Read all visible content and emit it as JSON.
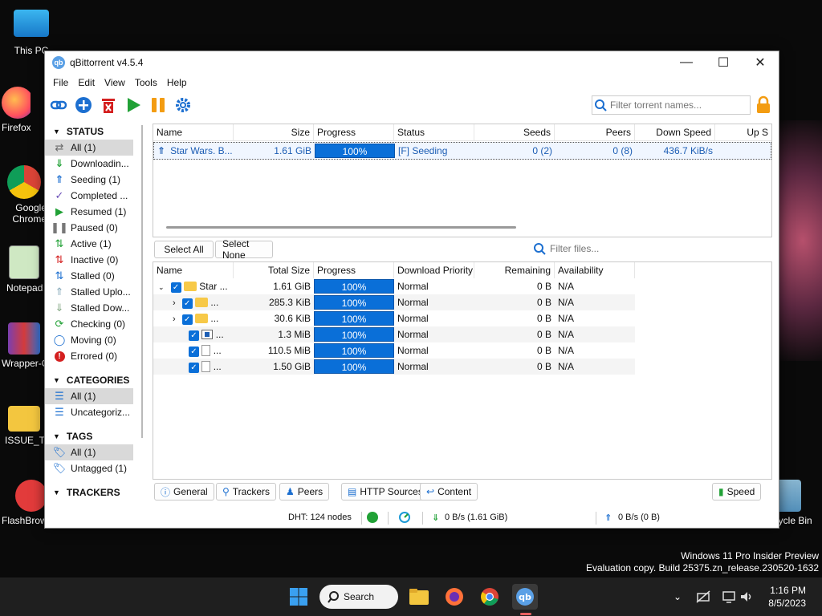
{
  "desktop": {
    "icons": [
      {
        "label": "This PC"
      },
      {
        "label": "Firefox"
      },
      {
        "label": "Google Chrome"
      },
      {
        "label": "Notepad"
      },
      {
        "label": "Wrapper-C"
      },
      {
        "label": "ISSUE_TE"
      },
      {
        "label": "FlashBrowser"
      },
      {
        "label": "Recycle Bin"
      }
    ],
    "watermark_line1": "Windows 11 Pro Insider Preview",
    "watermark_line2": "Evaluation copy. Build 25375.zn_release.230520-1632"
  },
  "window": {
    "title": "qBittorrent v4.5.4",
    "menu": [
      "File",
      "Edit",
      "View",
      "Tools",
      "Help"
    ],
    "search_placeholder": "Filter torrent names..."
  },
  "sidebar": {
    "status_header": "STATUS",
    "status_items": [
      {
        "label": "All (1)",
        "icon": "all-icon"
      },
      {
        "label": "Downloadin...",
        "icon": "downloading-icon"
      },
      {
        "label": "Seeding (1)",
        "icon": "seeding-icon"
      },
      {
        "label": "Completed ...",
        "icon": "check-icon"
      },
      {
        "label": "Resumed (1)",
        "icon": "play-icon"
      },
      {
        "label": "Paused (0)",
        "icon": "pause-icon"
      },
      {
        "label": "Active (1)",
        "icon": "active-icon"
      },
      {
        "label": "Inactive (0)",
        "icon": "inactive-icon"
      },
      {
        "label": "Stalled (0)",
        "icon": "stalled-icon"
      },
      {
        "label": "Stalled Uplo...",
        "icon": "stalled-upload-icon"
      },
      {
        "label": "Stalled Dow...",
        "icon": "stalled-download-icon"
      },
      {
        "label": "Checking (0)",
        "icon": "checking-icon"
      },
      {
        "label": "Moving (0)",
        "icon": "moving-icon"
      },
      {
        "label": "Errored (0)",
        "icon": "error-icon"
      }
    ],
    "categories_header": "CATEGORIES",
    "category_items": [
      {
        "label": "All (1)"
      },
      {
        "label": "Uncategoriz..."
      }
    ],
    "tags_header": "TAGS",
    "tag_items": [
      {
        "label": "All (1)"
      },
      {
        "label": "Untagged (1)"
      }
    ],
    "trackers_header": "TRACKERS"
  },
  "torrents": {
    "columns": [
      "Name",
      "Size",
      "Progress",
      "Status",
      "Seeds",
      "Peers",
      "Down Speed",
      "Up S"
    ],
    "rows": [
      {
        "name": "Star Wars. B...",
        "size": "1.61 GiB",
        "progress": "100%",
        "status": "[F] Seeding",
        "seeds": "0 (2)",
        "peers": "0 (8)",
        "down_speed": "436.7 KiB/s",
        "up_speed": ""
      }
    ]
  },
  "files": {
    "select_all": "Select All",
    "select_none": "Select None",
    "filter_placeholder": "Filter files...",
    "columns": [
      "Name",
      "Total Size",
      "Progress",
      "Download Priority",
      "Remaining",
      "Availability"
    ],
    "rows": [
      {
        "name": "Star ...",
        "size": "1.61 GiB",
        "progress": "100%",
        "priority": "Normal",
        "remaining": "0 B",
        "availability": "N/A"
      },
      {
        "name": "...",
        "size": "285.3 KiB",
        "progress": "100%",
        "priority": "Normal",
        "remaining": "0 B",
        "availability": "N/A"
      },
      {
        "name": "...",
        "size": "30.6 KiB",
        "progress": "100%",
        "priority": "Normal",
        "remaining": "0 B",
        "availability": "N/A"
      },
      {
        "name": "...",
        "size": "1.3 MiB",
        "progress": "100%",
        "priority": "Normal",
        "remaining": "0 B",
        "availability": "N/A"
      },
      {
        "name": "...",
        "size": "110.5 MiB",
        "progress": "100%",
        "priority": "Normal",
        "remaining": "0 B",
        "availability": "N/A"
      },
      {
        "name": "...",
        "size": "1.50 GiB",
        "progress": "100%",
        "priority": "Normal",
        "remaining": "0 B",
        "availability": "N/A"
      }
    ]
  },
  "tabs": {
    "general": "General",
    "trackers": "Trackers",
    "peers": "Peers",
    "http_sources": "HTTP Sources",
    "content": "Content",
    "speed": "Speed"
  },
  "statusbar": {
    "dht": "DHT: 124 nodes",
    "download": "0 B/s (1.61 GiB)",
    "upload": "0 B/s (0 B)"
  },
  "taskbar": {
    "search_label": "Search",
    "time": "1:16 PM",
    "date": "8/5/2023"
  },
  "colors": {
    "accent": "#0a6fd8",
    "seeding_text": "#1c5db4"
  }
}
